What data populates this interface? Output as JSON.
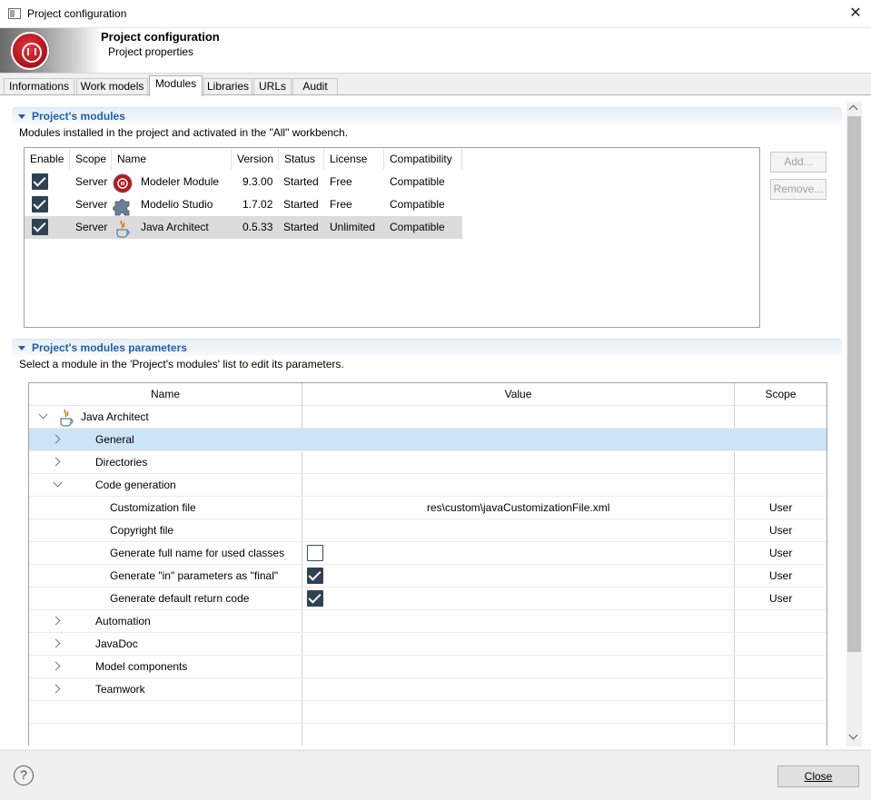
{
  "window": {
    "title": "Project configuration",
    "close_glyph": "✕"
  },
  "banner": {
    "title": "Project configuration",
    "subtitle": "Project properties",
    "logo_icon": "modelio-logo-icon"
  },
  "tabs": [
    {
      "label": "Informations",
      "active": false
    },
    {
      "label": "Work models",
      "active": false
    },
    {
      "label": "Modules",
      "active": true
    },
    {
      "label": "Libraries",
      "active": false
    },
    {
      "label": "URLs",
      "active": false
    },
    {
      "label": "Audit",
      "active": false
    }
  ],
  "modules_section": {
    "title": "Project's modules",
    "description": "Modules installed in the project and activated in the \"All\" workbench.",
    "columns": [
      "Enable",
      "Scope",
      "Name",
      "Version",
      "Status",
      "License",
      "Compatibility"
    ],
    "rows": [
      {
        "enabled": true,
        "scope": "Server",
        "icon": "modeler-module-icon",
        "name": "Modeler Module",
        "version": "9.3.00",
        "status": "Started",
        "license": "Free",
        "compatibility": "Compatible"
      },
      {
        "enabled": true,
        "scope": "Server",
        "icon": "puzzle-icon",
        "name": "Modelio Studio",
        "version": "1.7.02",
        "status": "Started",
        "license": "Free",
        "compatibility": "Compatible"
      },
      {
        "enabled": true,
        "scope": "Server",
        "icon": "java-icon",
        "name": "Java Architect",
        "version": "0.5.33",
        "status": "Started",
        "license": "Unlimited",
        "compatibility": "Compatible",
        "selected": true
      }
    ],
    "add_label": "Add...",
    "remove_label": "Remove..."
  },
  "params_section": {
    "title": "Project's modules parameters",
    "description": "Select a module in the 'Project's modules' list to edit its parameters.",
    "columns": {
      "name": "Name",
      "value": "Value",
      "scope": "Scope"
    },
    "root": "Java Architect",
    "rows": [
      {
        "label": "General",
        "value": "",
        "scope": ""
      },
      {
        "label": "Directories",
        "value": "",
        "scope": ""
      },
      {
        "label": "Code generation",
        "value": "",
        "scope": ""
      },
      {
        "label": "Customization file",
        "value": "res\\custom\\javaCustomizationFile.xml",
        "scope": "User"
      },
      {
        "label": "Copyright file",
        "value": "",
        "scope": "User"
      },
      {
        "label": "Generate full name for used classes",
        "value": "false",
        "scope": "User"
      },
      {
        "label": "Generate \"in\" parameters as \"final\"",
        "value": "true",
        "scope": "User"
      },
      {
        "label": "Generate default return code",
        "value": "true",
        "scope": "User"
      },
      {
        "label": "Automation",
        "value": "",
        "scope": ""
      },
      {
        "label": "JavaDoc",
        "value": "",
        "scope": ""
      },
      {
        "label": "Model components",
        "value": "",
        "scope": ""
      },
      {
        "label": "Teamwork",
        "value": "",
        "scope": ""
      }
    ]
  },
  "footer": {
    "help_glyph": "?",
    "close_label": "Close"
  },
  "colors": {
    "section_title": "#1f5fa8",
    "checkbox": "#2f4154",
    "tree_selection": "#cce4f7",
    "table_selection": "#dcdcdc"
  }
}
